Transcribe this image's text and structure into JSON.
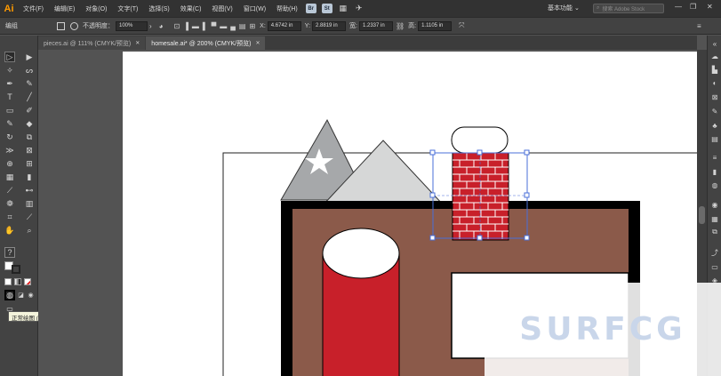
{
  "app": {
    "logo": "Ai"
  },
  "menu": [
    "文件(F)",
    "编辑(E)",
    "对象(O)",
    "文字(T)",
    "选择(S)",
    "效果(C)",
    "视图(V)",
    "窗口(W)",
    "帮助(H)"
  ],
  "menubar_badges": [
    {
      "label": "Br",
      "color": "#b9c7d6"
    },
    {
      "label": "St",
      "color": "#b9c7d6"
    }
  ],
  "workspace": {
    "label": "基本功能 ⌄"
  },
  "search": {
    "placeholder": "搜索 Adobe Stock"
  },
  "controlbar": {
    "mode_label": "编组",
    "opacity_label": "不透明度：",
    "opacity_value": "100%",
    "x_label": "X:",
    "x_value": "4.6742 in",
    "y_label": "Y:",
    "y_value": "2.8819 in",
    "w_label": "宽:",
    "w_value": "1.2337 in",
    "h_label": "高:",
    "h_value": "1.1105 in"
  },
  "tabs": [
    {
      "label": "pieces.ai @ 111% (CMYK/预览)",
      "active": false
    },
    {
      "label": "homesale.ai* @ 200% (CMYK/预览)",
      "active": true
    }
  ],
  "tooltip": {
    "text": "正常绘图 (Shift+D 切换模式)"
  },
  "watermark": {
    "text": "SURFCG"
  },
  "artwork": {
    "colors": {
      "house_wall": "#8b5a4a",
      "house_frame": "#000000",
      "chimney_brick": "#c8202a",
      "cylinder": "#c8202a",
      "mountain_back": "#a6a8aa",
      "mountain_front": "#d6d7d7",
      "selection": "#4a6fd8"
    }
  }
}
